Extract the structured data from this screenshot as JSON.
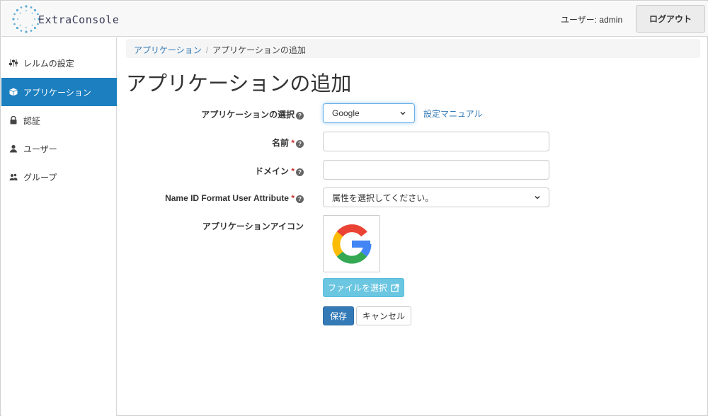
{
  "header": {
    "app_name": "ExtraConsole",
    "user_label": "ユーザー: admin",
    "logout_label": "ログアウト"
  },
  "sidebar": {
    "items": [
      {
        "label": "レルムの設定",
        "icon": "sliders-icon",
        "active": false
      },
      {
        "label": "アプリケーション",
        "icon": "cube-icon",
        "active": true
      },
      {
        "label": "認証",
        "icon": "lock-icon",
        "active": false
      },
      {
        "label": "ユーザー",
        "icon": "user-icon",
        "active": false
      },
      {
        "label": "グループ",
        "icon": "users-icon",
        "active": false
      }
    ]
  },
  "breadcrumb": {
    "parent": "アプリケーション",
    "separator": "/",
    "current": "アプリケーションの追加"
  },
  "page_title": "アプリケーションの追加",
  "form": {
    "app_select": {
      "label": "アプリケーションの選択",
      "value": "Google",
      "help_icon": "question-circle-icon"
    },
    "manual_link": "設定マニュアル",
    "name": {
      "label": "名前",
      "required_mark": "*",
      "value": "",
      "placeholder": ""
    },
    "domain": {
      "label": "ドメイン",
      "required_mark": "*",
      "value": "",
      "placeholder": ""
    },
    "name_id_format": {
      "label": "Name ID Format User Attribute",
      "required_mark": "*",
      "value": "属性を選択してください。"
    },
    "app_icon": {
      "label": "アプリケーションアイコン",
      "icon": "google-logo-icon"
    },
    "file_button": "ファイルを選択",
    "save_button": "保存",
    "cancel_button": "キャンセル"
  },
  "colors": {
    "accent": "#1c7fbf",
    "link": "#337ab7",
    "primary_button": "#337ab7",
    "info_button": "#5bc0de",
    "required": "#c9302c"
  }
}
